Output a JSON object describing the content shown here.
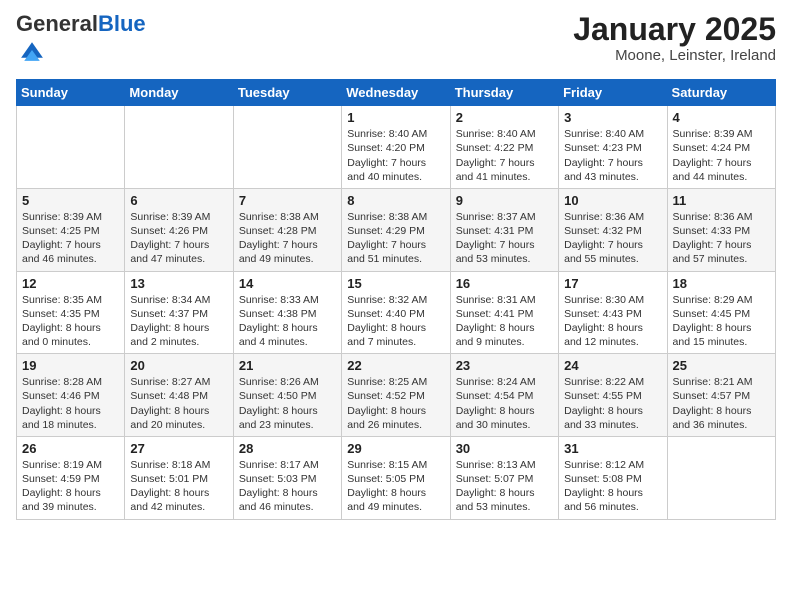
{
  "header": {
    "logo_general": "General",
    "logo_blue": "Blue",
    "title": "January 2025",
    "subtitle": "Moone, Leinster, Ireland"
  },
  "days_of_week": [
    "Sunday",
    "Monday",
    "Tuesday",
    "Wednesday",
    "Thursday",
    "Friday",
    "Saturday"
  ],
  "weeks": [
    [
      {
        "day": "",
        "info": ""
      },
      {
        "day": "",
        "info": ""
      },
      {
        "day": "",
        "info": ""
      },
      {
        "day": "1",
        "info": "Sunrise: 8:40 AM\nSunset: 4:20 PM\nDaylight: 7 hours\nand 40 minutes."
      },
      {
        "day": "2",
        "info": "Sunrise: 8:40 AM\nSunset: 4:22 PM\nDaylight: 7 hours\nand 41 minutes."
      },
      {
        "day": "3",
        "info": "Sunrise: 8:40 AM\nSunset: 4:23 PM\nDaylight: 7 hours\nand 43 minutes."
      },
      {
        "day": "4",
        "info": "Sunrise: 8:39 AM\nSunset: 4:24 PM\nDaylight: 7 hours\nand 44 minutes."
      }
    ],
    [
      {
        "day": "5",
        "info": "Sunrise: 8:39 AM\nSunset: 4:25 PM\nDaylight: 7 hours\nand 46 minutes."
      },
      {
        "day": "6",
        "info": "Sunrise: 8:39 AM\nSunset: 4:26 PM\nDaylight: 7 hours\nand 47 minutes."
      },
      {
        "day": "7",
        "info": "Sunrise: 8:38 AM\nSunset: 4:28 PM\nDaylight: 7 hours\nand 49 minutes."
      },
      {
        "day": "8",
        "info": "Sunrise: 8:38 AM\nSunset: 4:29 PM\nDaylight: 7 hours\nand 51 minutes."
      },
      {
        "day": "9",
        "info": "Sunrise: 8:37 AM\nSunset: 4:31 PM\nDaylight: 7 hours\nand 53 minutes."
      },
      {
        "day": "10",
        "info": "Sunrise: 8:36 AM\nSunset: 4:32 PM\nDaylight: 7 hours\nand 55 minutes."
      },
      {
        "day": "11",
        "info": "Sunrise: 8:36 AM\nSunset: 4:33 PM\nDaylight: 7 hours\nand 57 minutes."
      }
    ],
    [
      {
        "day": "12",
        "info": "Sunrise: 8:35 AM\nSunset: 4:35 PM\nDaylight: 8 hours\nand 0 minutes."
      },
      {
        "day": "13",
        "info": "Sunrise: 8:34 AM\nSunset: 4:37 PM\nDaylight: 8 hours\nand 2 minutes."
      },
      {
        "day": "14",
        "info": "Sunrise: 8:33 AM\nSunset: 4:38 PM\nDaylight: 8 hours\nand 4 minutes."
      },
      {
        "day": "15",
        "info": "Sunrise: 8:32 AM\nSunset: 4:40 PM\nDaylight: 8 hours\nand 7 minutes."
      },
      {
        "day": "16",
        "info": "Sunrise: 8:31 AM\nSunset: 4:41 PM\nDaylight: 8 hours\nand 9 minutes."
      },
      {
        "day": "17",
        "info": "Sunrise: 8:30 AM\nSunset: 4:43 PM\nDaylight: 8 hours\nand 12 minutes."
      },
      {
        "day": "18",
        "info": "Sunrise: 8:29 AM\nSunset: 4:45 PM\nDaylight: 8 hours\nand 15 minutes."
      }
    ],
    [
      {
        "day": "19",
        "info": "Sunrise: 8:28 AM\nSunset: 4:46 PM\nDaylight: 8 hours\nand 18 minutes."
      },
      {
        "day": "20",
        "info": "Sunrise: 8:27 AM\nSunset: 4:48 PM\nDaylight: 8 hours\nand 20 minutes."
      },
      {
        "day": "21",
        "info": "Sunrise: 8:26 AM\nSunset: 4:50 PM\nDaylight: 8 hours\nand 23 minutes."
      },
      {
        "day": "22",
        "info": "Sunrise: 8:25 AM\nSunset: 4:52 PM\nDaylight: 8 hours\nand 26 minutes."
      },
      {
        "day": "23",
        "info": "Sunrise: 8:24 AM\nSunset: 4:54 PM\nDaylight: 8 hours\nand 30 minutes."
      },
      {
        "day": "24",
        "info": "Sunrise: 8:22 AM\nSunset: 4:55 PM\nDaylight: 8 hours\nand 33 minutes."
      },
      {
        "day": "25",
        "info": "Sunrise: 8:21 AM\nSunset: 4:57 PM\nDaylight: 8 hours\nand 36 minutes."
      }
    ],
    [
      {
        "day": "26",
        "info": "Sunrise: 8:19 AM\nSunset: 4:59 PM\nDaylight: 8 hours\nand 39 minutes."
      },
      {
        "day": "27",
        "info": "Sunrise: 8:18 AM\nSunset: 5:01 PM\nDaylight: 8 hours\nand 42 minutes."
      },
      {
        "day": "28",
        "info": "Sunrise: 8:17 AM\nSunset: 5:03 PM\nDaylight: 8 hours\nand 46 minutes."
      },
      {
        "day": "29",
        "info": "Sunrise: 8:15 AM\nSunset: 5:05 PM\nDaylight: 8 hours\nand 49 minutes."
      },
      {
        "day": "30",
        "info": "Sunrise: 8:13 AM\nSunset: 5:07 PM\nDaylight: 8 hours\nand 53 minutes."
      },
      {
        "day": "31",
        "info": "Sunrise: 8:12 AM\nSunset: 5:08 PM\nDaylight: 8 hours\nand 56 minutes."
      },
      {
        "day": "",
        "info": ""
      }
    ]
  ]
}
